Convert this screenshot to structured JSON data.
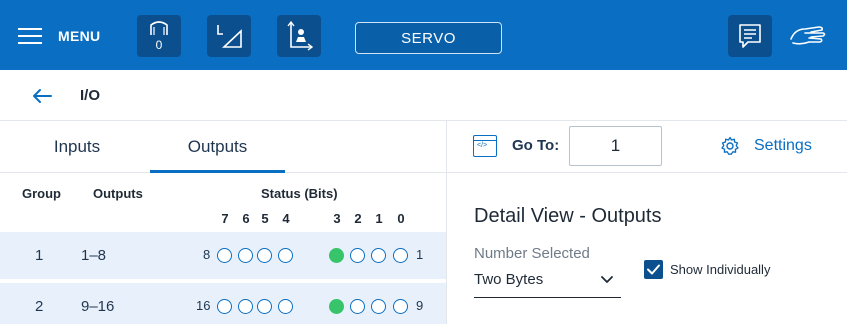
{
  "topbar": {
    "menu_label": "MENU",
    "tool_count": "0",
    "mode_label": "SERVO",
    "icons": [
      "hamburger-icon",
      "gripper-icon",
      "frame-icon",
      "tool-frame-icon",
      "message-icon",
      "hand-icon"
    ],
    "colors": {
      "bar": "#0a6ec2",
      "button": "#0b4f8e"
    }
  },
  "page": {
    "title": "I/O"
  },
  "tabs": [
    {
      "label": "Inputs",
      "active": false
    },
    {
      "label": "Outputs",
      "active": true
    }
  ],
  "goto": {
    "label": "Go To:",
    "value": "1"
  },
  "settings": {
    "label": "Settings"
  },
  "table": {
    "headers": {
      "group": "Group",
      "outputs": "Outputs",
      "status": "Status (Bits)"
    },
    "bit_numbers": [
      "7",
      "6",
      "5",
      "4",
      "3",
      "2",
      "1",
      "0"
    ],
    "rows": [
      {
        "group": "1",
        "outputs": "1–8",
        "high_label": "8",
        "low_label": "1",
        "bits": [
          false,
          false,
          false,
          false,
          true,
          false,
          false,
          false
        ]
      },
      {
        "group": "2",
        "outputs": "9–16",
        "high_label": "16",
        "low_label": "9",
        "bits": [
          false,
          false,
          false,
          false,
          true,
          false,
          false,
          false
        ]
      }
    ],
    "colors": {
      "bit_on": "#37c46a",
      "bit_off_border": "#0a6ec2",
      "row_bg": "#e8f1fb"
    }
  },
  "detail": {
    "title": "Detail View - Outputs",
    "number_selected_label": "Number Selected",
    "number_selected_value": "Two Bytes",
    "show_individually_label": "Show Individually",
    "show_individually_checked": true
  }
}
